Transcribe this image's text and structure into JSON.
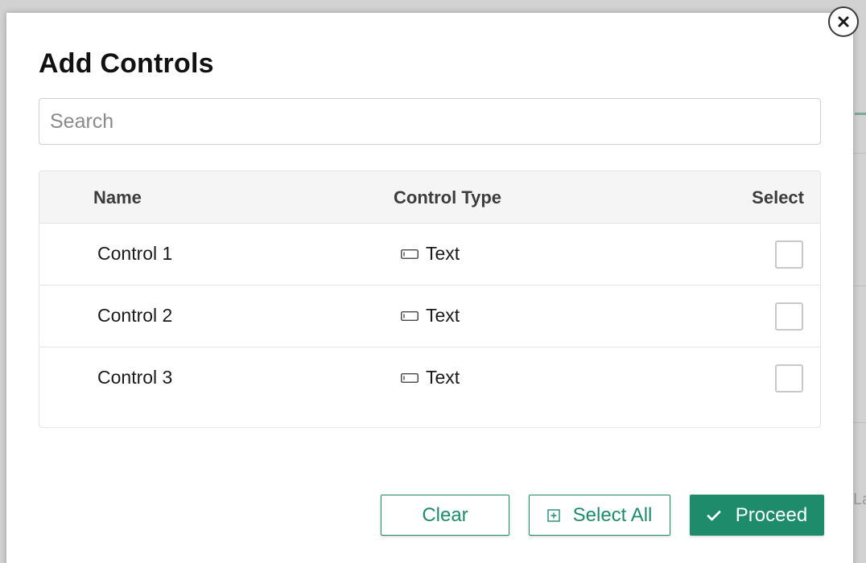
{
  "dialog": {
    "title": "Add Controls",
    "close_icon": "close-icon"
  },
  "search": {
    "placeholder": "Search",
    "value": ""
  },
  "table": {
    "columns": {
      "name": "Name",
      "control_type": "Control Type",
      "select": "Select"
    },
    "rows": [
      {
        "name": "Control 1",
        "type": "Text",
        "type_icon": "text-field-icon",
        "selected": false
      },
      {
        "name": "Control 2",
        "type": "Text",
        "type_icon": "text-field-icon",
        "selected": false
      },
      {
        "name": "Control 3",
        "type": "Text",
        "type_icon": "text-field-icon",
        "selected": false
      }
    ]
  },
  "actions": {
    "clear_label": "Clear",
    "select_all_label": "Select All",
    "select_all_icon": "plus-square-icon",
    "proceed_label": "Proceed",
    "proceed_icon": "check-icon"
  },
  "colors": {
    "accent": "#1e8c6a",
    "overlay": "#c9c9c9",
    "header_bg": "#f5f5f5",
    "border": "#e3e3e3"
  }
}
